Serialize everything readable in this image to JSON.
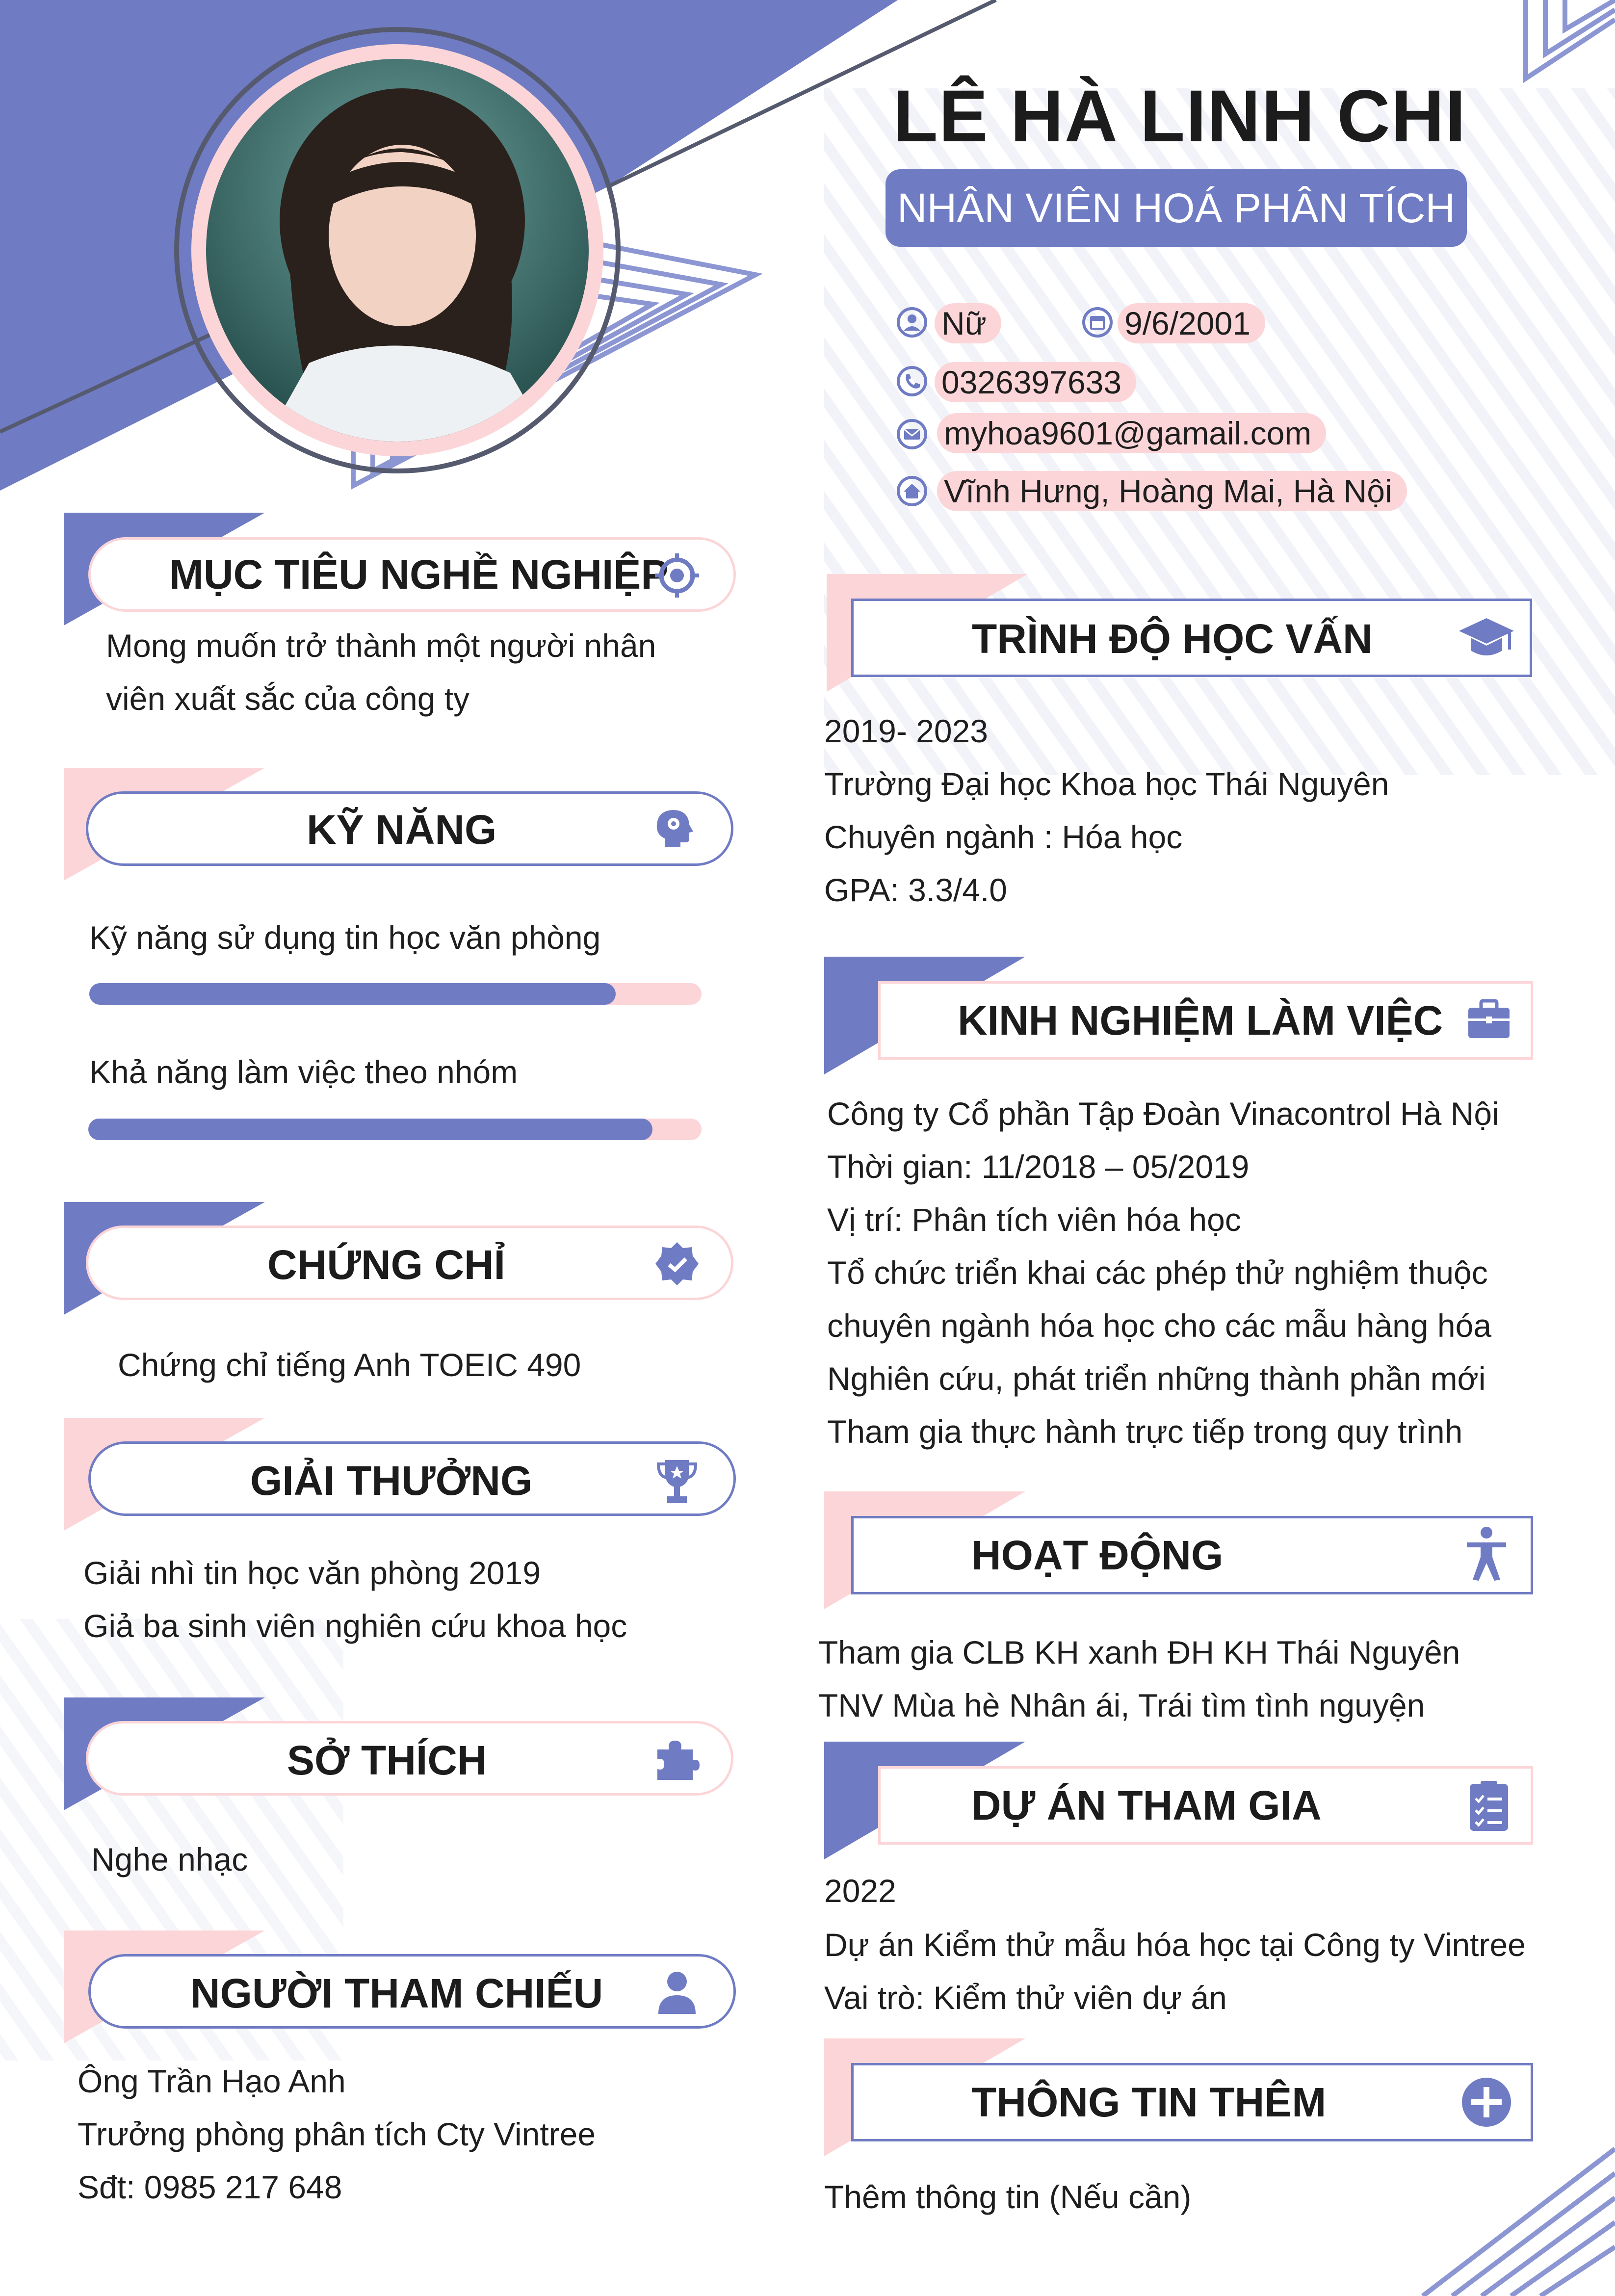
{
  "profile": {
    "name": "LÊ HÀ LINH CHI",
    "title": "NHÂN VIÊN HOÁ PHÂN TÍCH",
    "gender": "Nữ",
    "dob": "9/6/2001",
    "phone": "0326397633",
    "email": "myhoa9601@gamail.com",
    "address": "Vĩnh Hưng, Hoàng Mai, Hà Nội"
  },
  "icons": {
    "gender": "user-circle-icon",
    "dob": "calendar-icon",
    "phone": "phone-icon",
    "email": "mail-icon",
    "address": "home-icon"
  },
  "colors": {
    "accent": "#6f7bc3",
    "pink": "#fcd5d8",
    "text": "#1e1e1e"
  },
  "left": {
    "objective": {
      "title": "MỤC TIÊU NGHỀ NGHIỆP",
      "icon": "target-icon",
      "lines": [
        "Mong muốn trở thành một người nhân",
        "viên xuất sắc của công ty"
      ]
    },
    "skills": {
      "title": "KỸ NĂNG",
      "icon": "head-gear-icon",
      "items": [
        {
          "label": "Kỹ năng sử dụng tin học văn phòng",
          "level": 0.86
        },
        {
          "label": "Khả năng làm việc theo nhóm",
          "level": 0.92
        }
      ]
    },
    "certificates": {
      "title": "CHỨNG CHỈ",
      "icon": "verified-badge-icon",
      "lines": [
        "Chứng chỉ tiếng Anh TOEIC 490"
      ]
    },
    "awards": {
      "title": "GIẢI THƯỞNG",
      "icon": "trophy-icon",
      "lines": [
        "Giải nhì tin học văn phòng 2019",
        "Giả ba sinh viên nghiên cứu khoa học"
      ]
    },
    "hobbies": {
      "title": "SỞ THÍCH",
      "icon": "puzzle-icon",
      "lines": [
        "Nghe nhạc"
      ]
    },
    "references": {
      "title": "NGƯỜI THAM CHIẾU",
      "icon": "person-icon",
      "lines": [
        "Ông Trần Hạo Anh",
        "Trưởng phòng phân tích Cty Vintree",
        "Sđt: 0985 217 648"
      ]
    }
  },
  "right": {
    "education": {
      "title": "TRÌNH ĐỘ HỌC VẤN",
      "icon": "graduation-cap-icon",
      "lines": [
        "2019- 2023",
        "Trường Đại học Khoa học Thái Nguyên",
        "Chuyên ngành : Hóa học",
        "GPA: 3.3/4.0"
      ]
    },
    "experience": {
      "title": "KINH NGHIỆM LÀM VIỆC",
      "icon": "briefcase-icon",
      "lines": [
        "Công ty Cổ phần Tập Đoàn Vinacontrol Hà Nội",
        "Thời gian: 11/2018 – 05/2019",
        "Vị trí: Phân tích viên hóa học",
        "Tổ chức triển khai các phép thử nghiệm thuộc",
        "chuyên ngành hóa học cho các mẫu hàng hóa",
        "Nghiên cứu, phát triển những thành phần mới",
        "Tham gia thực hành trực tiếp trong quy trình"
      ]
    },
    "activities": {
      "title": "HOẠT ĐỘNG",
      "icon": "accessibility-person-icon",
      "lines": [
        "Tham gia CLB KH xanh ĐH KH Thái Nguyên",
        "TNV Mùa hè Nhân ái, Trái tìm tình nguyện"
      ]
    },
    "projects": {
      "title": "DỰ ÁN THAM GIA",
      "icon": "checklist-icon",
      "lines": [
        "2022",
        "Dự án Kiểm thử mẫu hóa học tại Công ty Vintree",
        "Vai trò: Kiểm thử viên dự án"
      ]
    },
    "extra": {
      "title": "THÔNG TIN THÊM",
      "icon": "plus-circle-icon",
      "lines": [
        "Thêm thông tin (Nếu cần)"
      ]
    }
  }
}
